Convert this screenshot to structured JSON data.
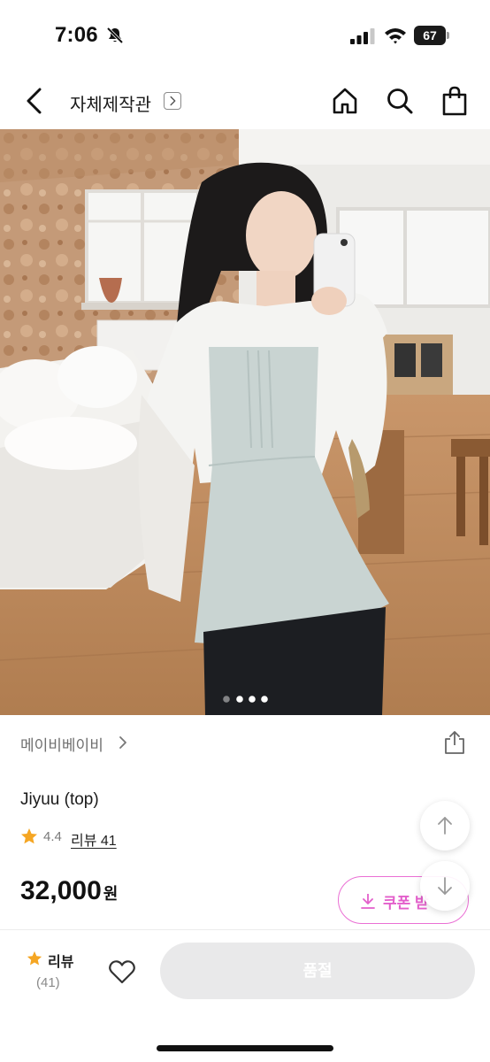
{
  "status_bar": {
    "time": "7:06",
    "battery": "67"
  },
  "header": {
    "store_name": "자체제작관",
    "store_arrow": ">"
  },
  "gallery": {
    "page_count": 4,
    "active_index": 1
  },
  "product": {
    "brand": "메이비베이비",
    "name": "Jiyuu (top)",
    "rating": "4.4",
    "review_link": "리뷰 41",
    "price": "32,000",
    "price_unit": "원"
  },
  "coupon": {
    "label": "쿠폰 받"
  },
  "bottom_bar": {
    "review_label": "리뷰",
    "review_count": "(41)",
    "buy_label": "품절"
  },
  "colors": {
    "accent_pink": "#e35fcb",
    "star_orange": "#f5a623",
    "soldout_gray": "#e9e9ea"
  },
  "icons": [
    "bell-muted-icon",
    "signal-icon",
    "wifi-icon",
    "back-icon",
    "home-icon",
    "search-icon",
    "bag-icon",
    "chevron-right-icon",
    "share-icon",
    "star-icon",
    "download-icon",
    "arrow-up-icon",
    "arrow-down-icon",
    "heart-icon"
  ]
}
